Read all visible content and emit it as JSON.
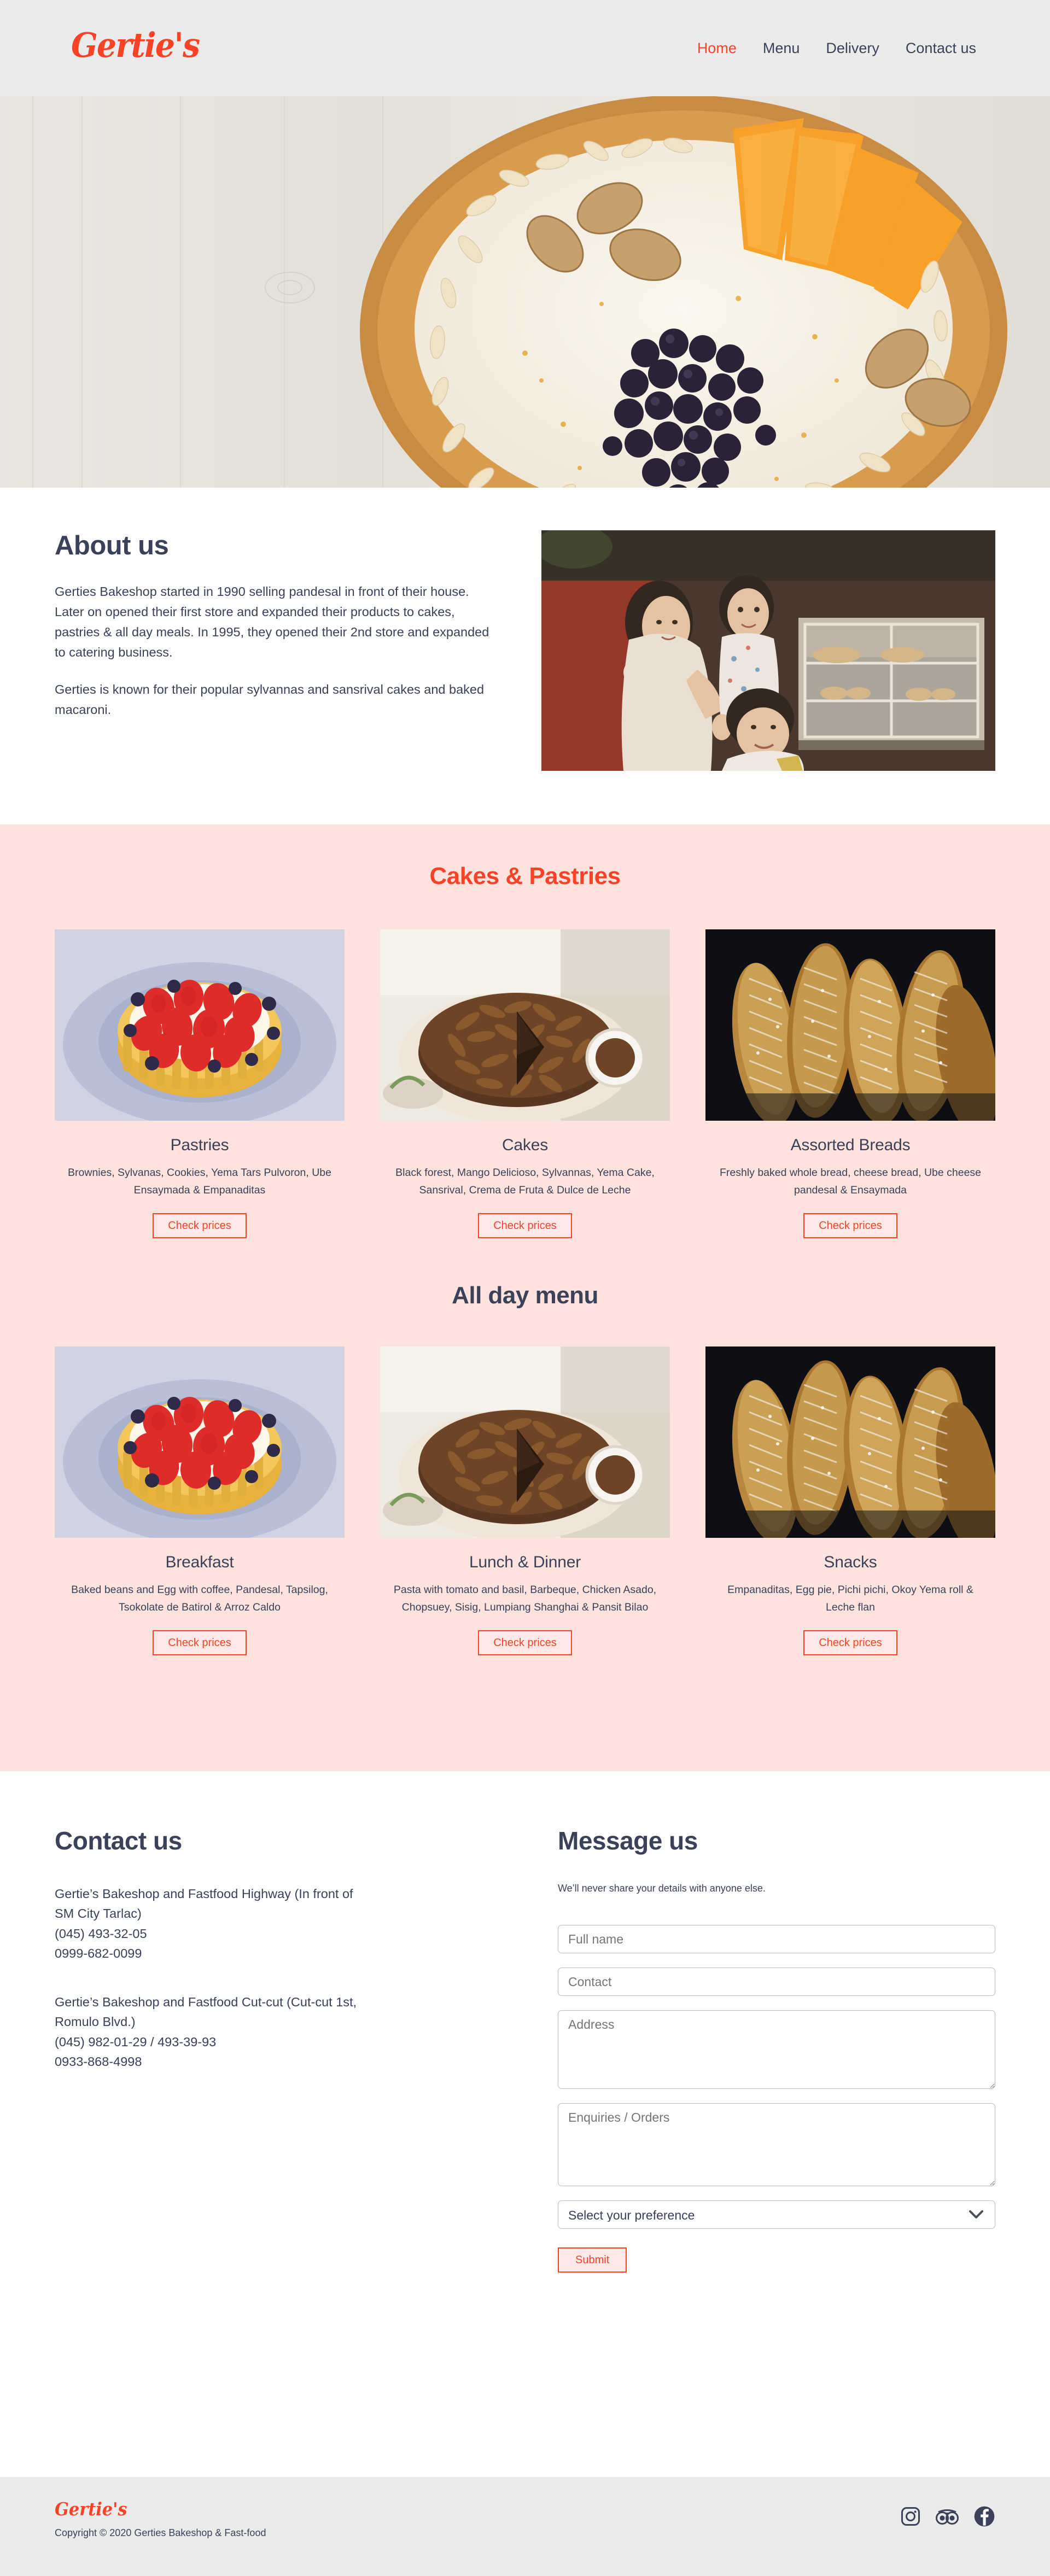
{
  "brand": {
    "name": "Gertie's",
    "logo_color": "#fa4226",
    "dark_color": "#3a4158",
    "pink_bg": "#fee2de",
    "header_bg": "#ebebeb"
  },
  "header": {
    "logo_text": "Gertie's",
    "nav": [
      {
        "label": "Home",
        "active": true
      },
      {
        "label": "Menu",
        "active": false
      },
      {
        "label": "Delivery",
        "active": false
      },
      {
        "label": "Contact us",
        "active": false
      }
    ]
  },
  "hero": {
    "alt": "Blueberry almond tart on whitewashed wooden board"
  },
  "about": {
    "title": "About us",
    "paragraph1": "Gerties Bakeshop started in 1990 selling pandesal in front of their house. Later on opened their first store and expanded their products to cakes, pastries & all day meals. In 1995, they opened their 2nd store and expanded to catering business.",
    "paragraph2": "Gerties is known for their popular sylvannas and sansrival cakes and baked macaroni.",
    "image_alt": "Vintage family photo in front of bakery display case"
  },
  "cakes_section": {
    "title": "Cakes & Pastries",
    "cards": [
      {
        "title": "Pastries",
        "description": "Brownies, Sylvanas, Cookies, Yema Tars Pulvoron, Ube Ensaymada & Empanaditas",
        "button": "Check prices",
        "image": "fruit-tart"
      },
      {
        "title": "Cakes",
        "description": "Black forest, Mango Delicioso, Sylvannas, Yema Cake, Sansrival, Crema de Fruta & Dulce de Leche",
        "button": "Check prices",
        "image": "chocolate-cake"
      },
      {
        "title": "Assorted Breads",
        "description": "Freshly baked whole bread, cheese bread, Ube cheese pandesal & Ensaymada",
        "button": "Check prices",
        "image": "bread-loaves"
      }
    ]
  },
  "allday_section": {
    "title": "All day menu",
    "cards": [
      {
        "title": "Breakfast",
        "description": "Baked beans and Egg with coffee, Pandesal, Tapsilog, Tsokolate de Batirol & Arroz Caldo",
        "button": "Check prices",
        "image": "fruit-tart"
      },
      {
        "title": "Lunch & Dinner",
        "description": "Pasta with tomato and basil, Barbeque, Chicken Asado, Chopsuey, Sisig, Lumpiang Shanghai & Pansit Bilao",
        "button": "Check prices",
        "image": "chocolate-cake"
      },
      {
        "title": "Snacks",
        "description": "Empanaditas, Egg pie, Pichi pichi, Okoy Yema roll & Leche flan",
        "button": "Check prices",
        "image": "bread-loaves"
      }
    ]
  },
  "contact": {
    "title": "Contact us",
    "branch1": "Gertie’s Bakeshop and Fastfood Highway (In front of SM City Tarlac)\n(045) 493-32-05\n0999-682-0099",
    "branch2": "Gertie’s Bakeshop and Fastfood Cut-cut (Cut-cut 1st, Romulo Blvd.)\n(045) 982-01-29 / 493-39-93\n0933-868-4998"
  },
  "message_form": {
    "title": "Message us",
    "note": "We’ll never share your details with anyone else.",
    "fullname_placeholder": "Full name",
    "contact_placeholder": "Contact",
    "address_placeholder": "Address",
    "enquiries_placeholder": "Enquiries / Orders",
    "select_value": "Select your preference",
    "submit_label": "Submit"
  },
  "footer": {
    "logo_text": "Gertie's",
    "copyright": "Copyright © 2020 Gerties Bakeshop & Fast-food",
    "socials": [
      "instagram",
      "tripadvisor",
      "facebook"
    ]
  }
}
